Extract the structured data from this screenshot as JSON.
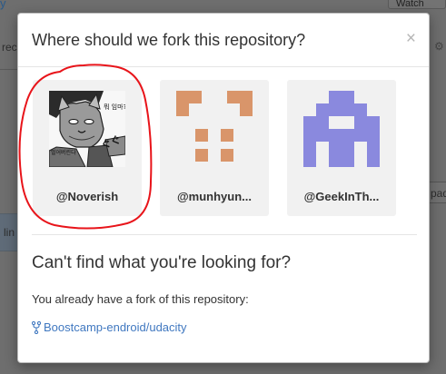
{
  "modal": {
    "title": "Where should we fork this repository?",
    "close_label": "×",
    "cant_find_heading": "Can't find what you're looking for?",
    "already_forked_text": "You already have a fork of this repository:",
    "existing_fork_link": "Boostcamp-endroid/udacity"
  },
  "fork_targets": [
    {
      "name": "@Noverish",
      "avatar": "comic-cat-avatar",
      "avatar_text_top": "뭐 임마?",
      "avatar_text_side": "벌어버린다"
    },
    {
      "name": "@munhyun...",
      "avatar": "identicon-orange",
      "color": "#d9956a"
    },
    {
      "name": "@GeekInTh...",
      "avatar": "identicon-purple",
      "color": "#8a89de"
    }
  ],
  "annotation": {
    "color": "#e8141a"
  },
  "background": {
    "watch_label": "Watch",
    "snippets": [
      "rec",
      "lin",
      "pad"
    ]
  }
}
